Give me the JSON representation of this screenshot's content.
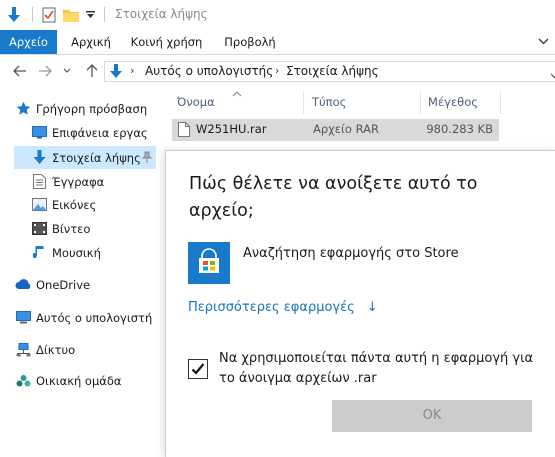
{
  "window": {
    "title": "Στοιχεία λήψης"
  },
  "ribbon": {
    "tabs": [
      "Αρχείο",
      "Αρχική",
      "Κοινή χρήση",
      "Προβολή"
    ]
  },
  "address": {
    "crumbs": [
      "Αυτός ο υπολογιστής",
      "Στοιχεία λήψης"
    ]
  },
  "sidebar": {
    "quick_access": "Γρήγορη πρόσβαση",
    "items": [
      "Επιφάνεια εργας",
      "Στοιχεία λήψης",
      "Έγγραφα",
      "Εικόνες",
      "Βίντεο",
      "Μουσική"
    ],
    "onedrive": "OneDrive",
    "this_pc": "Αυτός ο υπολογιστή",
    "network": "Δίκτυο",
    "homegroup": "Οικιακή ομάδα",
    "selected": "Στοιχεία λήψης"
  },
  "columns": {
    "name": "Όνομα",
    "type": "Τύπος",
    "size": "Μέγεθος"
  },
  "file": {
    "name": "W251HU.rar",
    "type": "Αρχείο RAR",
    "size": "980.283 KB"
  },
  "dialog": {
    "heading": "Πώς θέλετε να ανοίξετε αυτό το αρχείο;",
    "store_label": "Αναζήτηση εφαρμογής στο Store",
    "more_apps": "Περισσότερες εφαρμογές",
    "more_arrow": "↓",
    "always_label": "Να χρησιμοποιείται πάντα αυτή η εφαρμογή για το άνοιγμα αρχείων .rar",
    "always_checked": true,
    "ok": "OK"
  },
  "colors": {
    "accent": "#1979ca",
    "selection": "#cce8ff",
    "link": "#1a73c0"
  }
}
